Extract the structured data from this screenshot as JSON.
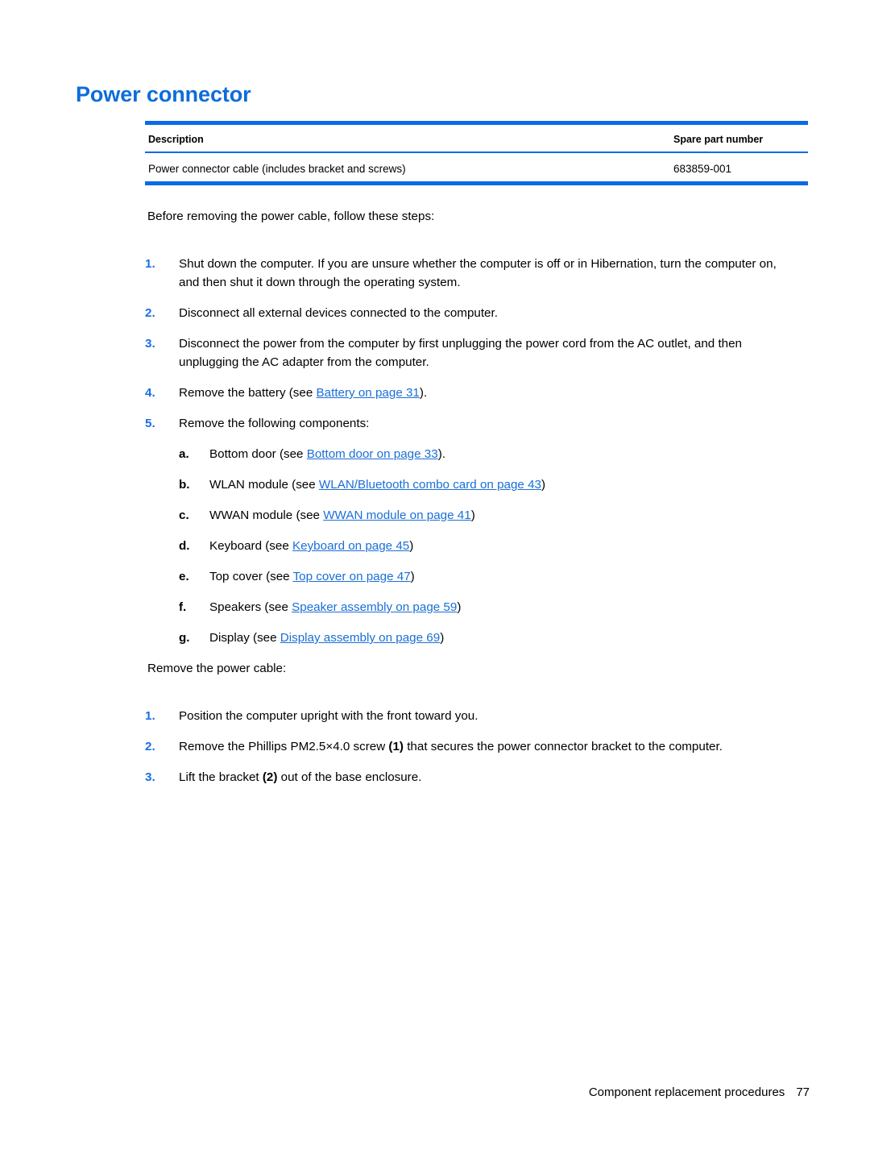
{
  "section": {
    "title": "Power connector"
  },
  "parts_table": {
    "columns": [
      "Description",
      "Spare part number"
    ],
    "rows": [
      {
        "description": "Power connector cable (includes bracket and screws)",
        "spare_part_number": "683859-001"
      }
    ],
    "rule_color": "#0b6ae8"
  },
  "before_section": {
    "intro": "Before removing the power cable, follow these steps:",
    "steps": [
      {
        "marker": "1.",
        "text": "Shut down the computer. If you are unsure whether the computer is off or in Hibernation, turn the computer on, and then shut it down through the operating system."
      },
      {
        "marker": "2.",
        "text": "Disconnect all external devices connected to the computer."
      },
      {
        "marker": "3.",
        "text": "Disconnect the power from the computer by first unplugging the power cord from the AC outlet, and then unplugging the AC adapter from the computer."
      },
      {
        "marker": "4.",
        "prefix": "Remove the battery (see ",
        "link": "Battery on page 31",
        "suffix": ")."
      },
      {
        "marker": "5.",
        "text": "Remove the following components:"
      }
    ],
    "components": [
      {
        "marker": "a.",
        "prefix": "Bottom door (see ",
        "link": "Bottom door on page 33",
        "suffix": ")."
      },
      {
        "marker": "b.",
        "prefix": "WLAN module (see ",
        "link": "WLAN/Bluetooth combo card on page 43",
        "suffix": ")"
      },
      {
        "marker": "c.",
        "prefix": "WWAN module (see ",
        "link": "WWAN module on page 41",
        "suffix": ")"
      },
      {
        "marker": "d.",
        "prefix": "Keyboard (see ",
        "link": "Keyboard on page 45",
        "suffix": ")"
      },
      {
        "marker": "e.",
        "prefix": "Top cover (see ",
        "link": "Top cover on page 47",
        "suffix": ")"
      },
      {
        "marker": "f.",
        "prefix": "Speakers (see ",
        "link": "Speaker assembly on page 59",
        "suffix": ")"
      },
      {
        "marker": "g.",
        "prefix": "Display (see ",
        "link": "Display assembly on page 69",
        "suffix": ")"
      }
    ]
  },
  "remove_section": {
    "intro": "Remove the power cable:",
    "steps": [
      {
        "marker": "1.",
        "text": "Position the computer upright with the front toward you."
      },
      {
        "marker": "2.",
        "part1": "Remove the Phillips PM2.5×4.0 screw ",
        "callout": "(1)",
        "part2": " that secures the power connector bracket to the computer."
      },
      {
        "marker": "3.",
        "part1": "Lift the bracket ",
        "callout": "(2)",
        "part2": " out of the base enclosure."
      }
    ]
  },
  "footer": {
    "title": "Component replacement procedures",
    "page_number": "77"
  }
}
